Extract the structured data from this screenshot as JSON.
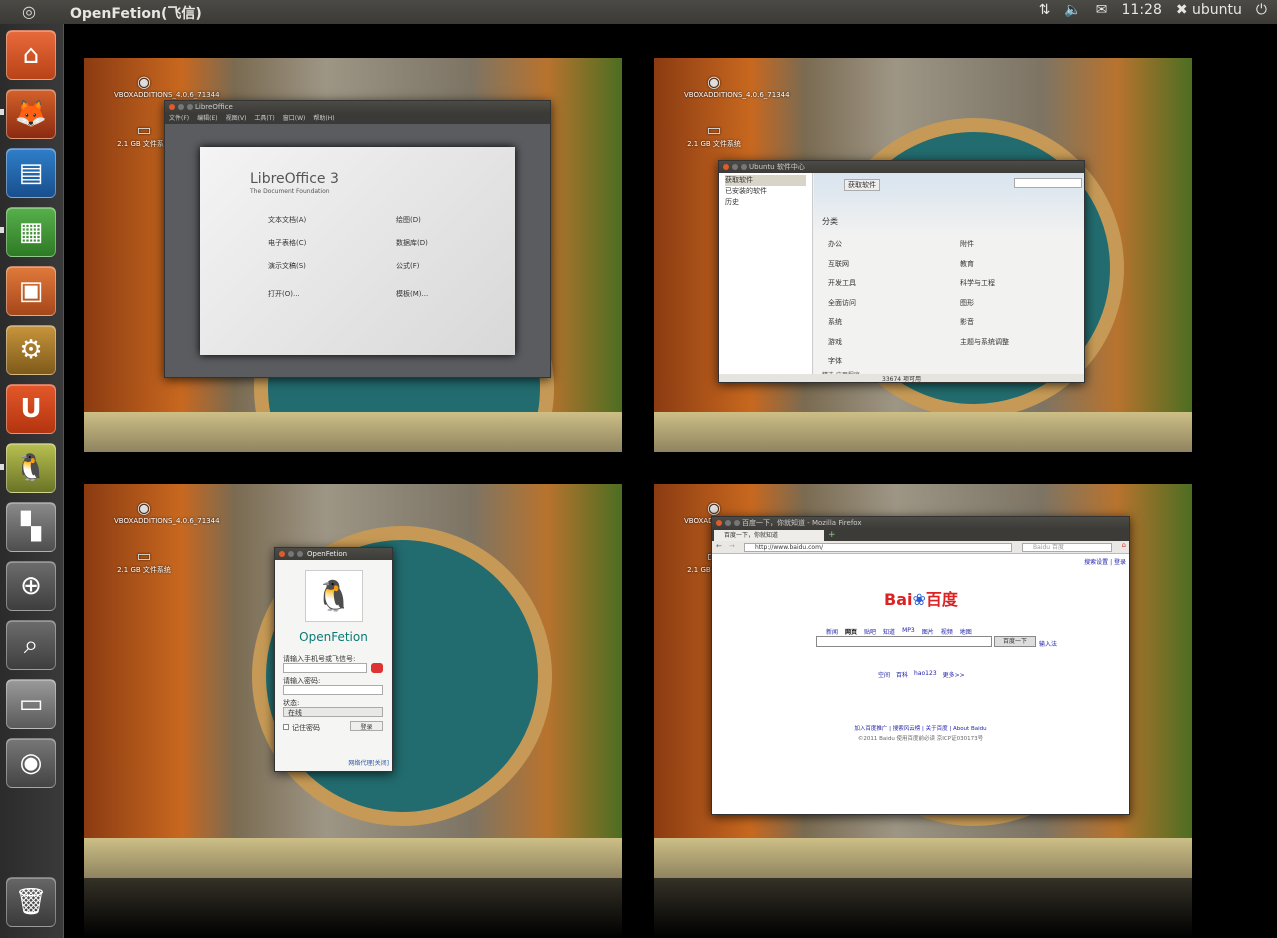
{
  "topbar": {
    "app_title": "OpenFetion(飞信)",
    "time": "11:28",
    "user": "ubuntu"
  },
  "desktop": {
    "icon1_label": "VBOXADDITIONS_4.0.6_71344",
    "icon2_label": "2.1 GB 文件系统"
  },
  "libreoffice": {
    "window_title": "LibreOffice",
    "menu": [
      "文件(F)",
      "编辑(E)",
      "视图(V)",
      "工具(T)",
      "窗口(W)",
      "帮助(H)"
    ],
    "brand": "LibreOffice 3",
    "foundation": "The Document Foundation",
    "items": [
      "文本文档(A)",
      "电子表格(C)",
      "演示文稿(S)",
      "打开(O)...",
      "绘图(D)",
      "数据库(D)",
      "公式(F)",
      "模板(M)..."
    ]
  },
  "software_center": {
    "window_title": "Ubuntu 软件中心",
    "side": [
      "获取软件",
      "已安装的软件",
      "历史"
    ],
    "crumb": "获取软件",
    "heading": "分类",
    "cats_left": [
      "办公",
      "互联网",
      "开发工具",
      "全面访问",
      "系统",
      "游戏",
      "字体"
    ],
    "cats_right": [
      "附件",
      "教育",
      "科学与工程",
      "图形",
      "影音",
      "主题与系统调整"
    ],
    "status": "33674 项可用",
    "featured": "精选 应用程序"
  },
  "fetion": {
    "window_title": "OpenFetion",
    "brand": "OpenFetion",
    "phone_label": "请输入手机号或飞信号:",
    "pwd_label": "请输入密码:",
    "status_label": "状态:",
    "status_value": "在线",
    "remember": "记住密码",
    "login": "登录",
    "proxy": "网络代理[关闭]"
  },
  "firefox": {
    "window_title": "百度一下，你就知道 - Mozilla Firefox",
    "tab": "百度一下，你就知道",
    "url": "http://www.baidu.com/",
    "search_placeholder": "Baidu 百度",
    "top_links": "搜索设置 | 登录",
    "logo_text": "百度",
    "nav": [
      "新闻",
      "网页",
      "贴吧",
      "知道",
      "MP3",
      "图片",
      "视频",
      "地图"
    ],
    "search_btn": "百度一下",
    "input_method": "输入法",
    "links": [
      "空间",
      "百科",
      "hao123",
      "更多>>"
    ],
    "footer_links": "加入百度推广 | 搜索风云榜 | 关于百度 | About Baidu",
    "copyright": "©2011 Baidu 使用百度前必读 京ICP证030173号"
  }
}
